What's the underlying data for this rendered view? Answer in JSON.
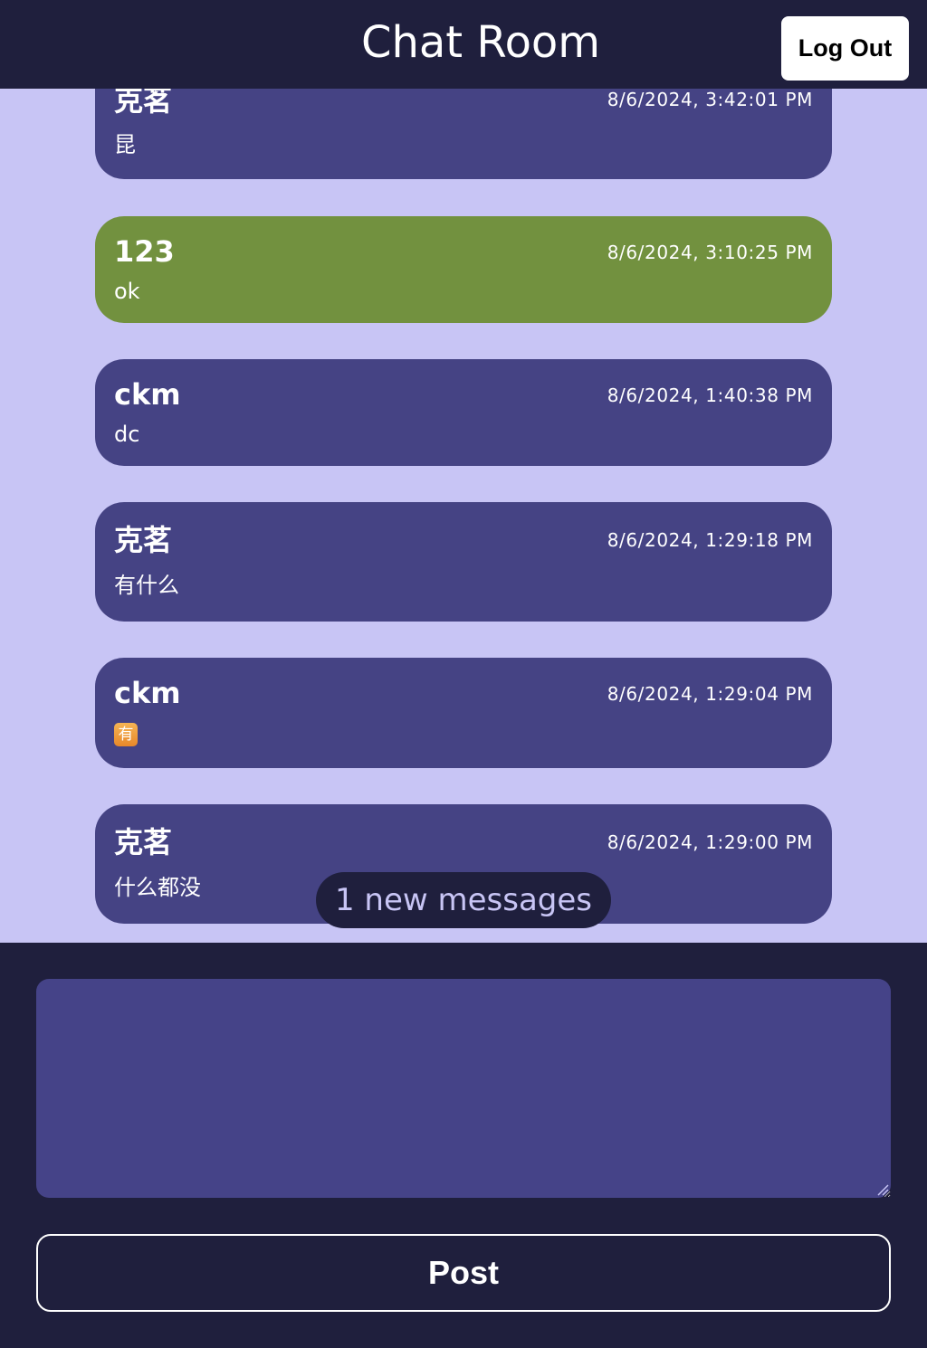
{
  "header": {
    "title": "Chat Room",
    "logout_label": "Log Out"
  },
  "messages": [
    {
      "user": "克茗",
      "time": "8/6/2024, 3:42:01 PM",
      "text": "昆",
      "mine": false
    },
    {
      "user": "123",
      "time": "8/6/2024, 3:10:25 PM",
      "text": "ok",
      "mine": true
    },
    {
      "user": "ckm",
      "time": "8/6/2024, 1:40:38 PM",
      "text": "dc",
      "mine": false
    },
    {
      "user": "克茗",
      "time": "8/6/2024, 1:29:18 PM",
      "text": "有什么",
      "mine": false
    },
    {
      "user": "ckm",
      "time": "8/6/2024, 1:29:04 PM",
      "text": "🈶",
      "mine": false
    },
    {
      "user": "克茗",
      "time": "8/6/2024, 1:29:00 PM",
      "text": "什么都没",
      "mine": false
    }
  ],
  "new_messages_label": "1 new messages",
  "composer": {
    "placeholder": "",
    "value": "",
    "post_label": "Post"
  },
  "colors": {
    "header_bg": "#1f1f3d",
    "messages_bg": "#c8c5f5",
    "bubble_other": "#454384",
    "bubble_mine": "#72913f",
    "input_bg": "#454388"
  },
  "icons": {
    "emoji": "squared-cjk-have-emoji-icon",
    "resize": "resize-handle-icon"
  }
}
